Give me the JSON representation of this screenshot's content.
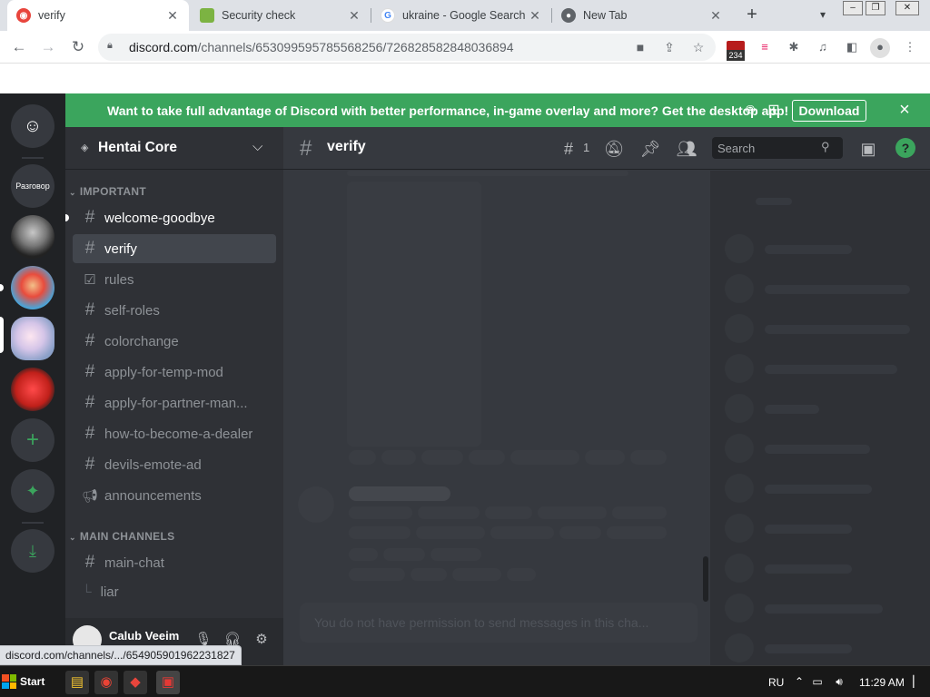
{
  "browser": {
    "tabs": [
      {
        "title": "verify",
        "favicon": "discord-favicon",
        "active": true
      },
      {
        "title": "Security check",
        "favicon": "shield-favicon",
        "active": false
      },
      {
        "title": "ukraine - Google Search",
        "favicon": "google-favicon",
        "active": false
      },
      {
        "title": "New Tab",
        "favicon": "chrome-favicon",
        "active": false
      }
    ],
    "new_tab_symbol": "+",
    "close_symbol": "✕",
    "url_host": "discord.com",
    "url_path": "/channels/653099595785568256/726828582848036894",
    "extension_badge": "234",
    "status_url": "discord.com/channels/.../654905901962231827"
  },
  "banner": {
    "message": "Want to take full advantage of Discord with better performance, in-game overlay and more? Get the desktop app!",
    "download_label": "Download",
    "platforms": [
      "apple-icon",
      "android-icon",
      "windows-icon"
    ],
    "color": "#3ba55d"
  },
  "guilds": [
    {
      "name": "home",
      "label": "",
      "kind": "discord-home"
    },
    {
      "name": "razgovor",
      "label": "Разговор",
      "kind": "text"
    },
    {
      "name": "server-avatar-1",
      "label": "",
      "kind": "image"
    },
    {
      "name": "server-avatar-2",
      "label": "",
      "kind": "image"
    },
    {
      "name": "server-avatar-3",
      "label": "",
      "kind": "image"
    },
    {
      "name": "server-avatar-4",
      "label": "",
      "kind": "image"
    }
  ],
  "server": {
    "name": "Hentai Core",
    "categories": [
      {
        "name": "IMPORTANT",
        "channels": [
          {
            "name": "welcome-goodbye",
            "icon": "hash-icon",
            "state": "unread"
          },
          {
            "name": "verify",
            "icon": "hash-icon",
            "state": "selected"
          },
          {
            "name": "rules",
            "icon": "rules-icon",
            "state": "normal"
          },
          {
            "name": "self-roles",
            "icon": "hash-icon",
            "state": "normal"
          },
          {
            "name": "colorchange",
            "icon": "hash-icon",
            "state": "normal"
          },
          {
            "name": "apply-for-temp-mod",
            "icon": "hash-icon",
            "state": "normal"
          },
          {
            "name": "apply-for-partner-man...",
            "icon": "hash-icon",
            "state": "normal"
          },
          {
            "name": "how-to-become-a-dealer",
            "icon": "hash-icon",
            "state": "normal"
          },
          {
            "name": "devils-emote-ad",
            "icon": "hash-icon",
            "state": "normal"
          },
          {
            "name": "announcements",
            "icon": "megaphone-icon",
            "state": "normal"
          }
        ]
      },
      {
        "name": "MAIN CHANNELS",
        "channels": [
          {
            "name": "main-chat",
            "icon": "hash-icon",
            "state": "normal"
          }
        ],
        "threads": [
          "liar"
        ]
      }
    ]
  },
  "user": {
    "name": "Calub Veeim"
  },
  "chat": {
    "channel": "verify",
    "thread_count": "1",
    "search_placeholder": "Search",
    "composer_placeholder": "You do not have permission to send messages in this cha..."
  },
  "taskbar": {
    "start_label": "Start",
    "language": "RU",
    "time": "11:29 AM"
  },
  "colors": {
    "discord_dark": "#202225",
    "sidebar": "#2f3136",
    "chat_bg": "#36393f",
    "accent_green": "#3ba55d"
  }
}
